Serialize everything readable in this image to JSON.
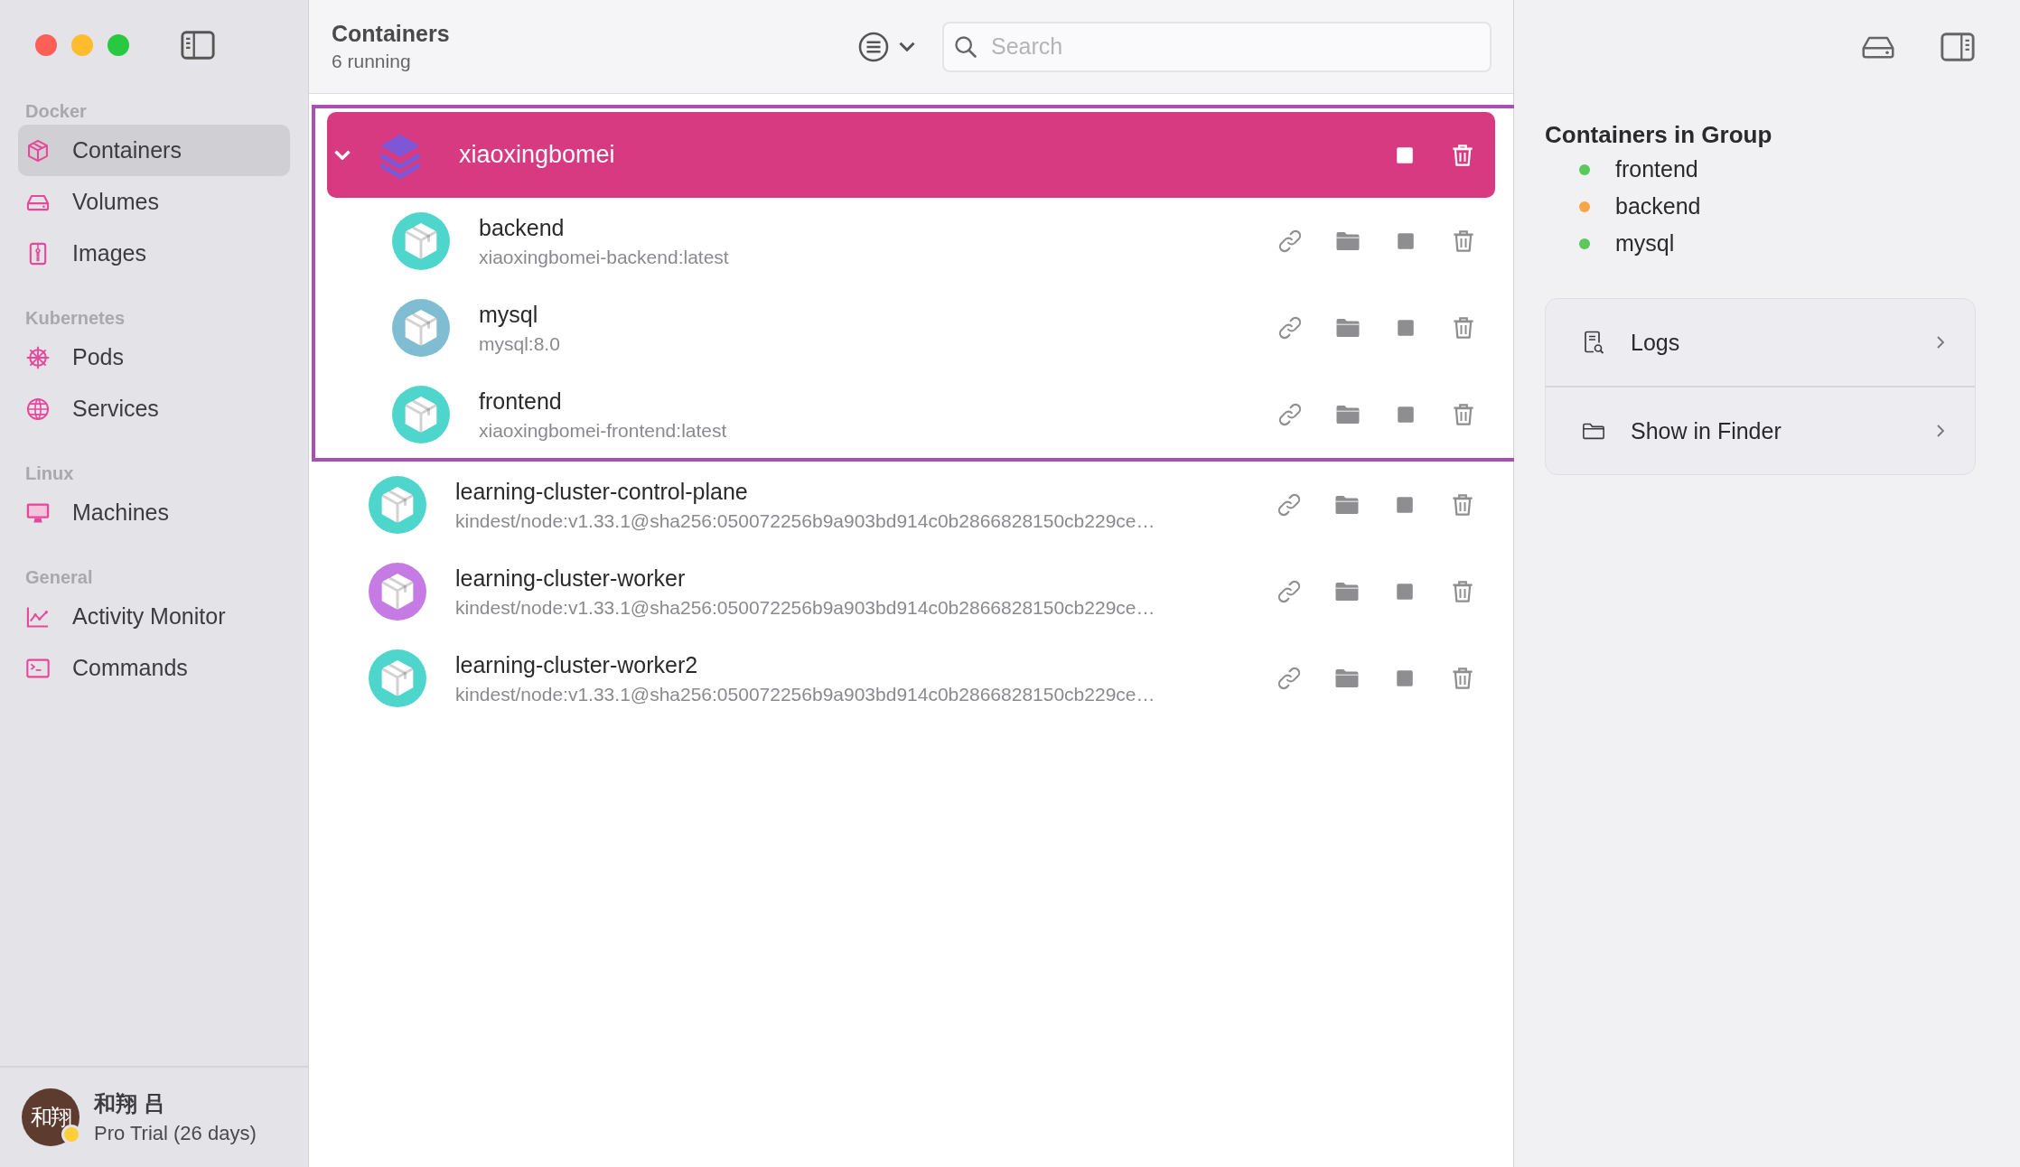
{
  "window": {
    "controls": [
      {
        "kind": "close"
      },
      {
        "kind": "minimize"
      },
      {
        "kind": "zoom"
      }
    ]
  },
  "sidebar": {
    "sections": [
      {
        "title": "Docker",
        "items": [
          {
            "label": "Containers",
            "kind": "cube",
            "selected": true
          },
          {
            "label": "Volumes",
            "kind": "drive",
            "selected": false
          },
          {
            "label": "Images",
            "kind": "archive",
            "selected": false
          }
        ]
      },
      {
        "title": "Kubernetes",
        "items": [
          {
            "label": "Pods",
            "kind": "helm",
            "selected": false
          },
          {
            "label": "Services",
            "kind": "globe",
            "selected": false
          }
        ]
      },
      {
        "title": "Linux",
        "items": [
          {
            "label": "Machines",
            "kind": "monitor",
            "selected": false
          }
        ]
      },
      {
        "title": "General",
        "items": [
          {
            "label": "Activity Monitor",
            "kind": "chart",
            "selected": false
          },
          {
            "label": "Commands",
            "kind": "terminal",
            "selected": false
          }
        ]
      }
    ],
    "account": {
      "avatar_text": "和翔",
      "name": "和翔 吕",
      "plan": "Pro Trial (26 days)"
    }
  },
  "header": {
    "title": "Containers",
    "subtitle": "6 running",
    "search": {
      "placeholder": "Search"
    }
  },
  "group": {
    "name": "xiaoxingbomei",
    "expanded": true,
    "selected": true,
    "containers": [
      {
        "name": "backend",
        "image": "xiaoxingbomei-backend:latest",
        "color": "#4fd6cc"
      },
      {
        "name": "mysql",
        "image": "mysql:8.0",
        "color": "#80bdd3"
      },
      {
        "name": "frontend",
        "image": "xiaoxingbomei-frontend:latest",
        "color": "#4fd6cc"
      }
    ]
  },
  "containers": [
    {
      "name": "learning-cluster-control-plane",
      "image": "kindest/node:v1.33.1@sha256:050072256b9a903bd914c0b2866828150cb229ce…",
      "color": "#4fd6cc"
    },
    {
      "name": "learning-cluster-worker",
      "image": "kindest/node:v1.33.1@sha256:050072256b9a903bd914c0b2866828150cb229ce…",
      "color": "#c57be3"
    },
    {
      "name": "learning-cluster-worker2",
      "image": "kindest/node:v1.33.1@sha256:050072256b9a903bd914c0b2866828150cb229ce…",
      "color": "#4fd6cc"
    }
  ],
  "inspector": {
    "title": "Containers in Group",
    "members": [
      {
        "name": "frontend",
        "color": "#5ac85a"
      },
      {
        "name": "backend",
        "color": "#f6a548"
      },
      {
        "name": "mysql",
        "color": "#5ac85a"
      }
    ],
    "actions": [
      {
        "label": "Logs",
        "kind": "logs"
      },
      {
        "label": "Show in Finder",
        "kind": "finder"
      }
    ]
  }
}
